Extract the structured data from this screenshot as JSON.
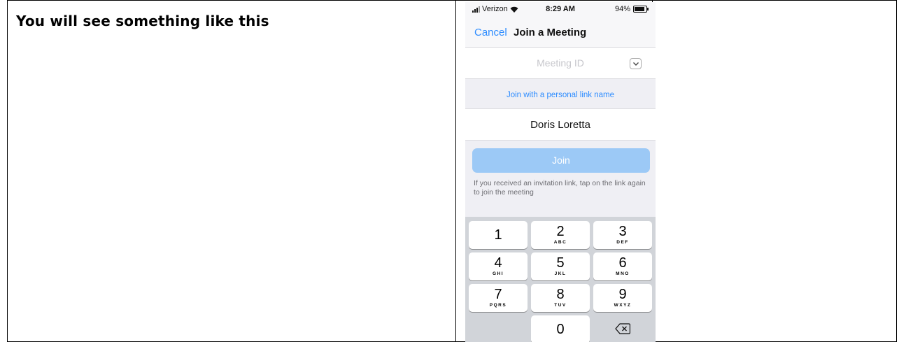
{
  "document": {
    "heading": "You will see something like this"
  },
  "status_bar": {
    "carrier": "Verizon",
    "time": "8:29 AM",
    "battery": "94%",
    "battery_level": 0.94
  },
  "nav": {
    "cancel_label": "Cancel",
    "title": "Join a Meeting"
  },
  "meeting_id": {
    "placeholder": "Meeting ID",
    "dropdown_icon": "chevron-down-icon"
  },
  "personal_link_label": "Join with a personal link name",
  "name_field": {
    "value": "Doris Loretta"
  },
  "join_button_label": "Join",
  "hint_text": "If you received an invitation link, tap on the link again to join the meeting",
  "keypad": {
    "keys": [
      {
        "num": "1",
        "letters": ""
      },
      {
        "num": "2",
        "letters": "ABC"
      },
      {
        "num": "3",
        "letters": "DEF"
      },
      {
        "num": "4",
        "letters": "GHI"
      },
      {
        "num": "5",
        "letters": "JKL"
      },
      {
        "num": "6",
        "letters": "MNO"
      },
      {
        "num": "7",
        "letters": "PQRS"
      },
      {
        "num": "8",
        "letters": "TUV"
      },
      {
        "num": "9",
        "letters": "WXYZ"
      },
      {
        "num": "0",
        "letters": ""
      }
    ],
    "backspace_icon": "backspace-icon"
  }
}
